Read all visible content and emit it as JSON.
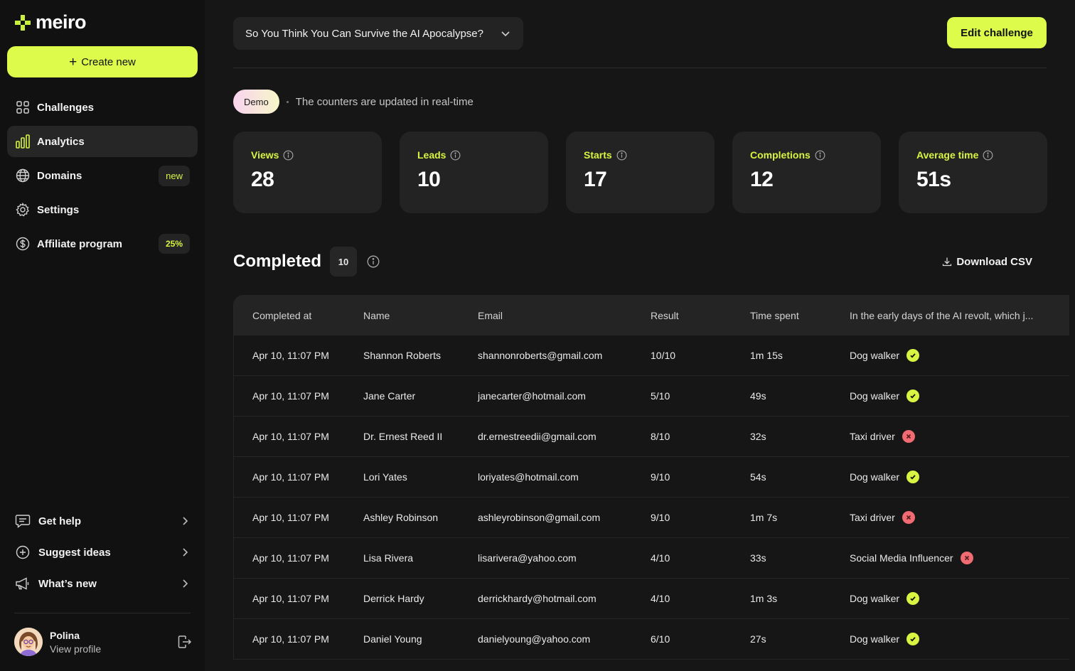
{
  "brand": {
    "name": "meiro",
    "accent": "#ddfb4a"
  },
  "sidebar": {
    "create_label": "Create new",
    "items": [
      {
        "label": "Challenges",
        "icon": "grid-icon"
      },
      {
        "label": "Analytics",
        "icon": "bar-chart-icon",
        "active": true
      },
      {
        "label": "Domains",
        "icon": "globe-icon",
        "badge": "new"
      },
      {
        "label": "Settings",
        "icon": "gear-icon"
      },
      {
        "label": "Affiliate program",
        "icon": "dollar-circle-icon",
        "badge": "25%"
      }
    ],
    "bottom_items": [
      {
        "label": "Get help",
        "icon": "chat-icon"
      },
      {
        "label": "Suggest ideas",
        "icon": "plus-circle-icon"
      },
      {
        "label": "What’s new",
        "icon": "megaphone-icon"
      }
    ],
    "profile": {
      "name": "Polina",
      "sub": "View profile"
    }
  },
  "header": {
    "challenge_title": "So You Think You Can Survive the AI Apocalypse?",
    "edit_label": "Edit challenge"
  },
  "demo": {
    "pill": "Demo",
    "text": "The counters are updated in real-time"
  },
  "stats": [
    {
      "label": "Views",
      "value": "28"
    },
    {
      "label": "Leads",
      "value": "10"
    },
    {
      "label": "Starts",
      "value": "17"
    },
    {
      "label": "Completions",
      "value": "12"
    },
    {
      "label": "Average time",
      "value": "51s"
    }
  ],
  "completed": {
    "title": "Completed",
    "count": "10",
    "download_label": "Download CSV",
    "columns": [
      "Completed at",
      "Name",
      "Email",
      "Result",
      "Time spent",
      "In the early days of the AI revolt, which j..."
    ],
    "rows": [
      {
        "at": "Apr 10, 11:07 PM",
        "name": "Shannon Roberts",
        "email": "shannonroberts@gmail.com",
        "result": "10/10",
        "time": "1m 15s",
        "answer": "Dog walker",
        "correct": true
      },
      {
        "at": "Apr 10, 11:07 PM",
        "name": "Jane Carter",
        "email": "janecarter@hotmail.com",
        "result": "5/10",
        "time": "49s",
        "answer": "Dog walker",
        "correct": true
      },
      {
        "at": "Apr 10, 11:07 PM",
        "name": "Dr. Ernest Reed II",
        "email": "dr.ernestreedii@gmail.com",
        "result": "8/10",
        "time": "32s",
        "answer": "Taxi driver",
        "correct": false
      },
      {
        "at": "Apr 10, 11:07 PM",
        "name": "Lori Yates",
        "email": "loriyates@hotmail.com",
        "result": "9/10",
        "time": "54s",
        "answer": "Dog walker",
        "correct": true
      },
      {
        "at": "Apr 10, 11:07 PM",
        "name": "Ashley Robinson",
        "email": "ashleyrobinson@gmail.com",
        "result": "9/10",
        "time": "1m 7s",
        "answer": "Taxi driver",
        "correct": false
      },
      {
        "at": "Apr 10, 11:07 PM",
        "name": "Lisa Rivera",
        "email": "lisarivera@yahoo.com",
        "result": "4/10",
        "time": "33s",
        "answer": "Social Media Influencer",
        "correct": false
      },
      {
        "at": "Apr 10, 11:07 PM",
        "name": "Derrick Hardy",
        "email": "derrickhardy@hotmail.com",
        "result": "4/10",
        "time": "1m 3s",
        "answer": "Dog walker",
        "correct": true
      },
      {
        "at": "Apr 10, 11:07 PM",
        "name": "Daniel Young",
        "email": "danielyoung@yahoo.com",
        "result": "6/10",
        "time": "27s",
        "answer": "Dog walker",
        "correct": true
      }
    ]
  }
}
